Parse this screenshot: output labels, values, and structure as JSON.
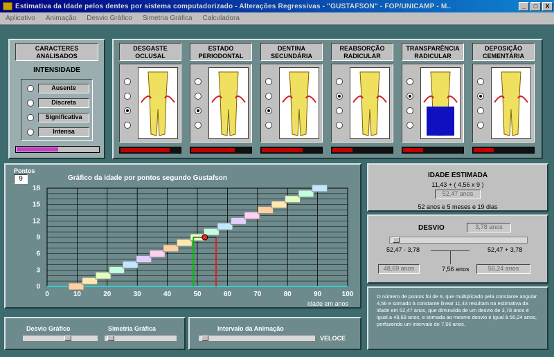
{
  "window": {
    "title": "Estimativa da Idade pelos dentes por sistema computadorizado - Alterações Regressivas - \"GUSTAFSON\" - FOP/UNICAMP - M..",
    "buttons": [
      "_",
      "□",
      "X"
    ]
  },
  "menu": [
    "Aplicativo",
    "Animação",
    "Desvio Gráfico",
    "Simetria Gráfica",
    "Calculadora"
  ],
  "characteristics": {
    "title": "CARACTERES\nANALISADOS",
    "intensity_label": "INTENSIDADE",
    "options": [
      "Ausente",
      "Discreta",
      "Significativa",
      "Intensa"
    ]
  },
  "teeth": [
    {
      "label": "DESGASTE\nOCLUSAL",
      "selected": 2,
      "gauge": 0.85
    },
    {
      "label": "ESTADO\nPERIODONTAL",
      "selected": 2,
      "gauge": 0.75
    },
    {
      "label": "DENTINA\nSECUNDÁRIA",
      "selected": 2,
      "gauge": 0.7
    },
    {
      "label": "REABSORÇÃO\nRADICULAR",
      "selected": 1,
      "gauge": 0.35
    },
    {
      "label": "TRANSPARÊNCIA\nRADICULAR",
      "selected": 1,
      "gauge": 0.35
    },
    {
      "label": "DEPOSIÇÃO\nCEMENTÁRIA",
      "selected": 1,
      "gauge": 0.35
    }
  ],
  "chart_header": {
    "points_label": "Pontos",
    "points_value": "9",
    "title": "Gráfico da idade por pontos segundo Gustafson",
    "xunit": "idade em anos"
  },
  "chart_data": {
    "type": "line",
    "title": "Gráfico da idade por pontos segundo Gustafson",
    "ylabel": "Pontos",
    "xlabel": "idade em anos",
    "xlim": [
      0,
      100
    ],
    "ylim": [
      0,
      18
    ],
    "yticks": [
      0,
      3,
      6,
      9,
      12,
      15,
      18
    ],
    "xticks": [
      0,
      10,
      20,
      30,
      40,
      50,
      60,
      70,
      80,
      90,
      100
    ],
    "grid": true,
    "x": [
      9,
      13.5,
      18,
      22.5,
      27,
      31.5,
      36,
      40.5,
      45,
      49.5,
      54,
      58.5,
      63,
      67.5,
      72,
      76.5,
      81,
      85.5,
      90
    ],
    "y": [
      0,
      1,
      2,
      3,
      4,
      5,
      6,
      7,
      8,
      9,
      10,
      11,
      12,
      13,
      14,
      15,
      16,
      17,
      18
    ],
    "marker": {
      "x": 52.47,
      "y": 9
    },
    "lines": {
      "lower": 48.69,
      "upper": 56.24
    }
  },
  "estimate": {
    "title": "IDADE ESTIMADA",
    "formula": "11,43 + ( 4,56 x 9 )",
    "value": "52,47 anos",
    "detail": "52 anos e 5 meses e 19 dias"
  },
  "desvio": {
    "title": "DESVIO",
    "value": "3,78 anos",
    "minus_label": "52,47 - 3,78",
    "plus_label": "52,47 + 3,78",
    "lower": "48,69 anos",
    "spread": "7,56 anos",
    "upper": "56,24 anos"
  },
  "explanation": "O número de pontos foi de 9, que multiplicado pela constante angular 4,56 e somado à constante linear 11,43 resultam na estimativa da idade em 52,47 anos, que diminuída de um desvio de 3,78 anos é igual a 48,69 anos, e somada ao mesmo desvio é igual à 56,24 anos, perfazendo um intervalo de 7,56 anos.",
  "controls": {
    "desvio_grafico": "Desvio Gráfico",
    "simetria_grafica": "Simetria Gráfica",
    "intervalo": "Intervalo da Animação",
    "veloce": "VELOCE"
  },
  "colors": {
    "line": "#ff2020",
    "green": "#00c000",
    "red": "#e02020",
    "gauge_purple": "#c040c0"
  }
}
